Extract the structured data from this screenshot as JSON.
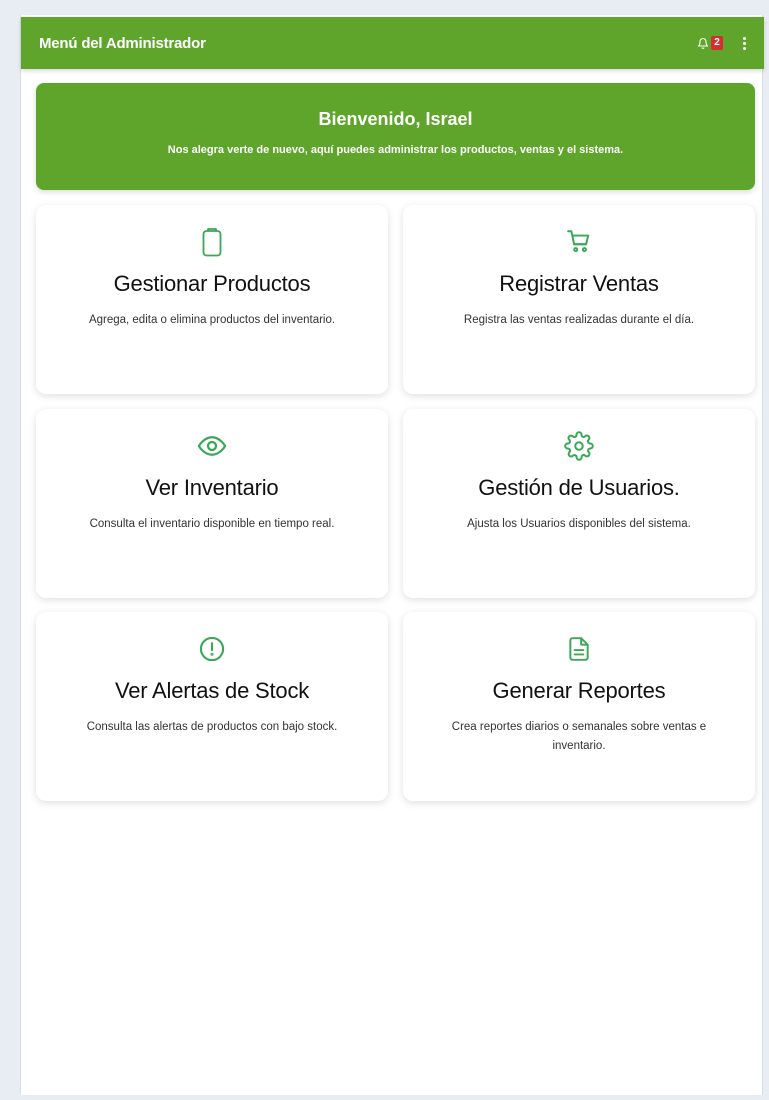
{
  "appbar": {
    "title": "Menú del Administrador",
    "notification_count": "2",
    "bell_icon": "bell-icon",
    "more_icon": "more-vertical-icon"
  },
  "welcome": {
    "title": "Bienvenido, Israel",
    "subtitle": "Nos alegra verte de nuevo, aquí puedes administrar los productos, ventas y el sistema."
  },
  "cards": [
    {
      "icon": "clipboard-icon",
      "title": "Gestionar Productos",
      "desc": "Agrega, edita o elimina productos del inventario."
    },
    {
      "icon": "cart-icon",
      "title": "Registrar Ventas",
      "desc": "Registra las ventas realizadas durante el día."
    },
    {
      "icon": "eye-icon",
      "title": "Ver Inventario",
      "desc": "Consulta el inventario disponible en tiempo real."
    },
    {
      "icon": "gear-icon",
      "title": "Gestión de Usuarios.",
      "desc": "Ajusta los Usuarios disponibles del sistema."
    },
    {
      "icon": "alert-circle-icon",
      "title": "Ver Alertas de Stock",
      "desc": "Consulta las alertas de productos con bajo stock."
    },
    {
      "icon": "document-icon",
      "title": "Generar Reportes",
      "desc": "Crea reportes diarios o semanales sobre ventas e inventario."
    }
  ],
  "colors": {
    "primary": "#5fa52b",
    "icon_green": "#3aa757",
    "badge": "#d32f2f"
  }
}
